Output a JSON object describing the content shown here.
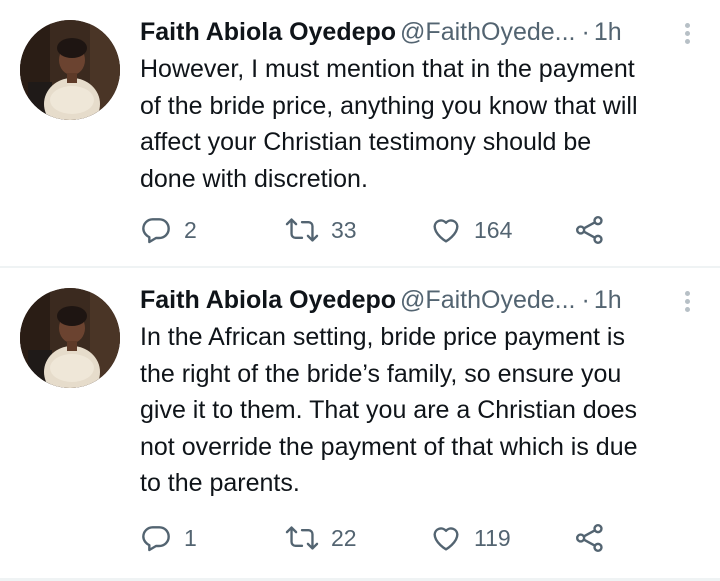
{
  "colors": {
    "text": "#0f1419",
    "secondary": "#536471",
    "divider": "#eff3f4",
    "background": "#ffffff"
  },
  "icons": {
    "reply": "reply-icon",
    "retweet": "retweet-icon",
    "like": "heart-icon",
    "share": "share-icon",
    "more": "more-options-icon"
  },
  "tweets": [
    {
      "author_name": "Faith Abiola Oyedepo",
      "handle": "@FaithOyede...",
      "separator": "·",
      "time": "1h",
      "text": "However, I must mention that in the payment\nof the bride price, anything you know that will\naffect your Christian testimony should be\ndone with discretion.",
      "replies": "2",
      "retweets": "33",
      "likes": "164"
    },
    {
      "author_name": "Faith Abiola Oyedepo",
      "handle": "@FaithOyede...",
      "separator": "·",
      "time": "1h",
      "text": "In the African setting, bride price payment is\nthe right of the bride’s family, so ensure you\ngive it to them. That you are a Christian does\nnot override the payment of that which is due\nto the parents.",
      "replies": "1",
      "retweets": "22",
      "likes": "119"
    }
  ]
}
